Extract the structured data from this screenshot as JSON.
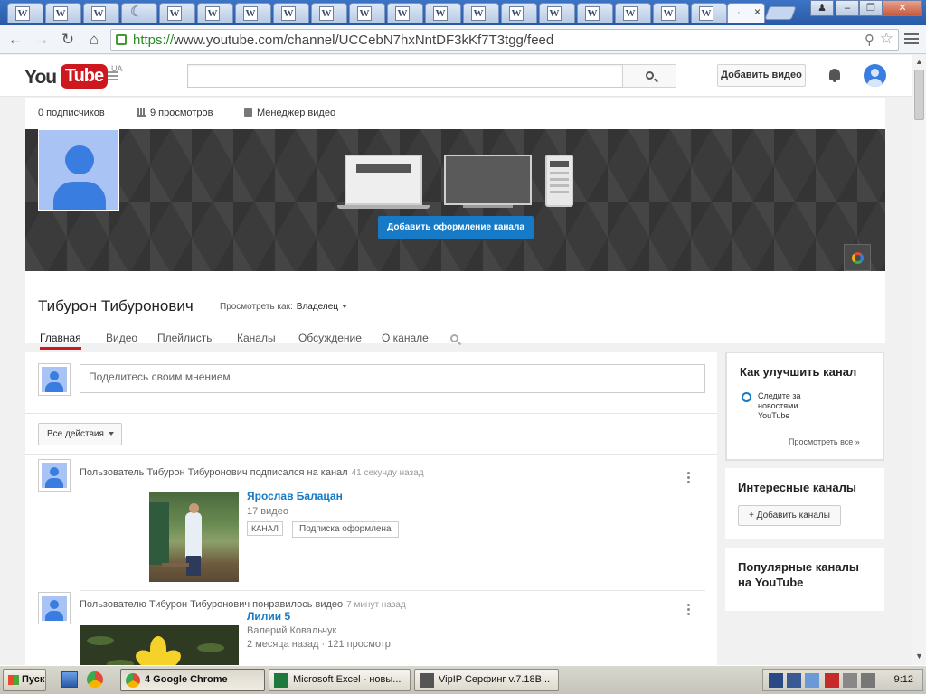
{
  "browser": {
    "tabs": [
      {
        "icon": "W"
      },
      {
        "icon": "W"
      },
      {
        "icon": "W"
      },
      {
        "icon": "moon"
      },
      {
        "icon": "W"
      },
      {
        "icon": "W"
      },
      {
        "icon": "W"
      },
      {
        "icon": "W"
      },
      {
        "icon": "W"
      },
      {
        "icon": "W"
      },
      {
        "icon": "W"
      },
      {
        "icon": "W"
      },
      {
        "icon": "W"
      },
      {
        "icon": "W"
      },
      {
        "icon": "W"
      },
      {
        "icon": "W"
      },
      {
        "icon": "W"
      },
      {
        "icon": "W"
      },
      {
        "icon": "W"
      }
    ],
    "active_tab_close": "×",
    "url_https": "https://",
    "url_rest": "www.youtube.com/channel/UCCebN7hxNntDF3kKf7T3tgg/feed"
  },
  "masthead": {
    "logo_you": "You",
    "logo_tube": "Tube",
    "region": "UA",
    "search_value": "",
    "upload_label": "Добавить видео"
  },
  "channel": {
    "subscribers": "0 подписчиков",
    "views": "9 просмотров",
    "video_manager": "Менеджер видео",
    "add_art_label": "Добавить оформление канала",
    "title": "Тибурон Тибуронович",
    "view_as_label": "Просмотреть как:",
    "view_as_value": "Владелец",
    "tabs": [
      "Главная",
      "Видео",
      "Плейлисты",
      "Каналы",
      "Обсуждение",
      "О канале"
    ],
    "active_tab": 0
  },
  "feed": {
    "share_placeholder": "Поделитесь своим мнением",
    "filter_label": "Все действия",
    "activities": [
      {
        "text": "Пользователь Тибурон Тибуронович подписался на канал",
        "time": "41 секунду назад",
        "item_title": "Ярослав Балацан",
        "item_meta": "17 видео",
        "tag": "КАНАЛ",
        "subscribed_label": "Подписка оформлена"
      },
      {
        "text": "Пользователю Тибурон Тибуронович понравилось видео",
        "time": "7 минут назад",
        "item_title": "Лилии 5",
        "item_author": "Валерий Ковальчук",
        "item_meta": "2 месяца назад · 121 просмотр"
      }
    ]
  },
  "sidebar": {
    "improve_title": "Как улучшить канал",
    "improve_item": "Следите за новостями YouTube",
    "view_all": "Просмотреть все  »",
    "interesting_title": "Интересные каналы",
    "add_channels": "+ Добавить каналы",
    "popular_title": "Популярные каналы на YouTube"
  },
  "taskbar": {
    "start": "Пуск",
    "windows": [
      {
        "label": "4 Google Chrome",
        "pressed": true
      },
      {
        "label": "Microsoft Excel - новы...",
        "pressed": false
      },
      {
        "label": "VipIP Серфинг  v.7.18B...",
        "pressed": false
      }
    ],
    "clock": "9:12"
  },
  "colors": {
    "yt_red": "#cc181e",
    "yt_blue": "#167ac6",
    "avatar_blue": "#3a7de0"
  }
}
